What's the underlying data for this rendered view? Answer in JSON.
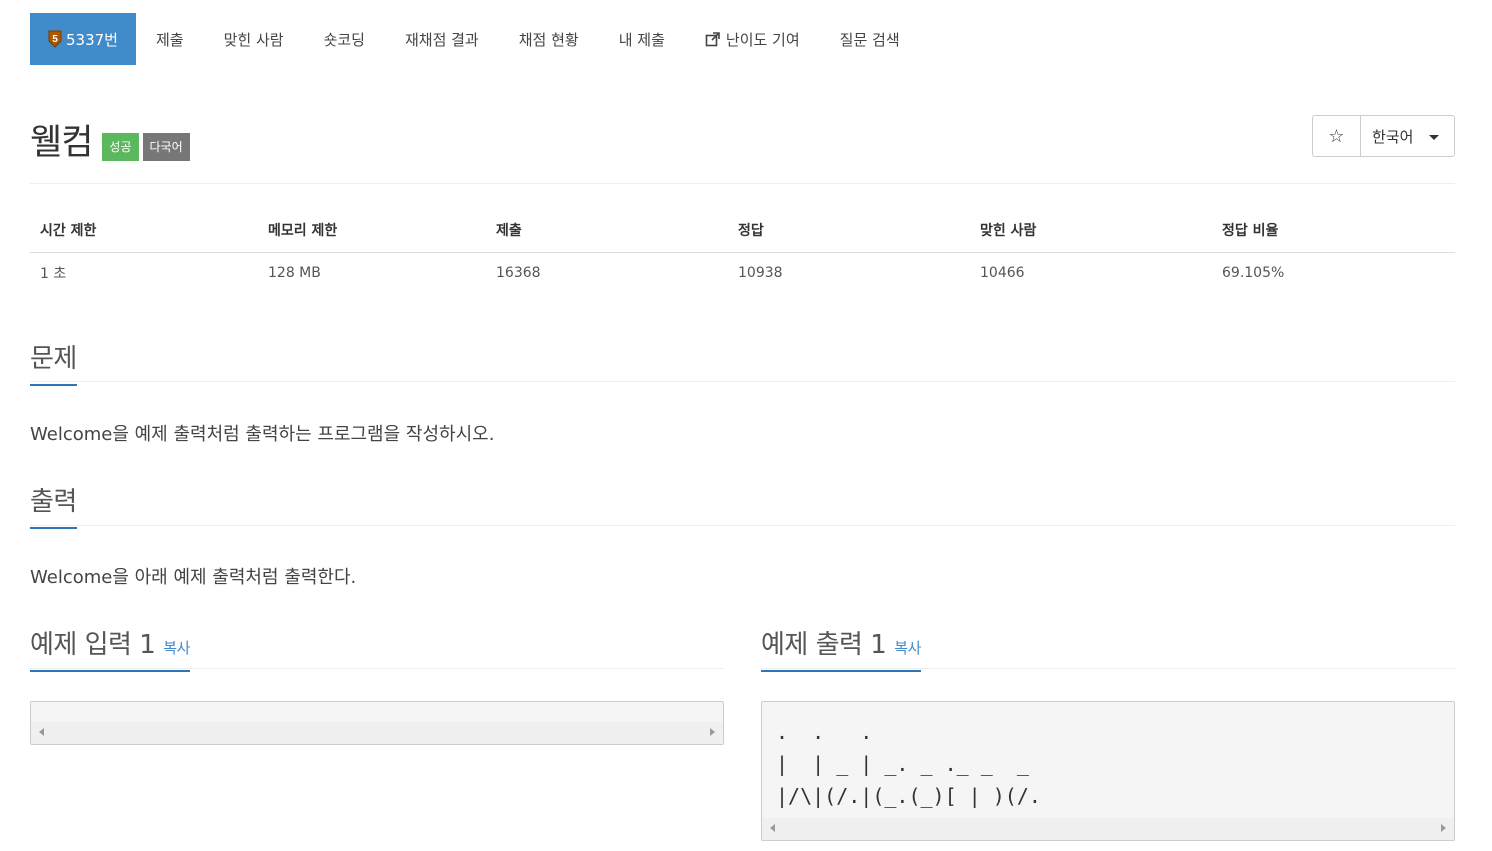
{
  "nav": {
    "problem_tab": "5337번",
    "tier_badge": "5",
    "items": [
      "제출",
      "맞힌 사람",
      "숏코딩",
      "재채점 결과",
      "채점 현황",
      "내 제출",
      "난이도 기여",
      "질문 검색"
    ]
  },
  "title": "웰컴",
  "labels": {
    "success": "성공",
    "multilang": "다국어"
  },
  "toolbar": {
    "star_icon": "☆",
    "language": "한국어"
  },
  "info": {
    "headers": [
      "시간 제한",
      "메모리 제한",
      "제출",
      "정답",
      "맞힌 사람",
      "정답 비율"
    ],
    "values": [
      "1 초",
      "128 MB",
      "16368",
      "10938",
      "10466",
      "69.105%"
    ]
  },
  "problem": {
    "heading": "문제",
    "text": "Welcome을 예제 출력처럼 출력하는 프로그램을 작성하시오."
  },
  "output": {
    "heading": "출력",
    "text": "Welcome을 아래 예제 출력처럼 출력한다."
  },
  "sample_input": {
    "heading": "예제 입력 1",
    "copy": "복사",
    "content": ""
  },
  "sample_output": {
    "heading": "예제 출력 1",
    "copy": "복사",
    "content": ".  .   .\n|  | _ | _. _ ._ _  _\n|/\\|(/.|(_.(_)[ | )(/."
  },
  "colors": {
    "tab_active": "#428bca",
    "success": "#5cb85c",
    "multilang": "#777777",
    "accent": "#2f74b5"
  }
}
